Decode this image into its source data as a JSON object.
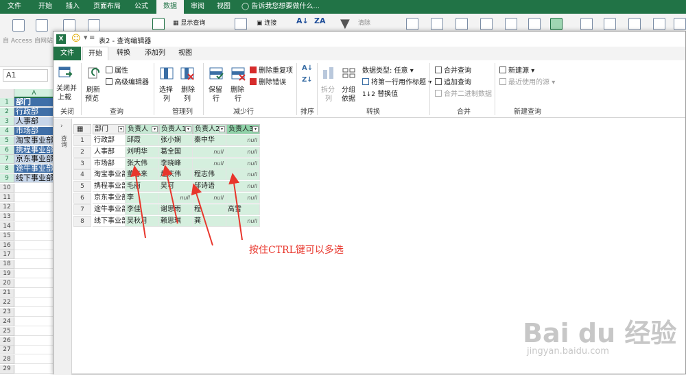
{
  "excel": {
    "tabs": [
      {
        "label": "文件"
      },
      {
        "label": "开始"
      },
      {
        "label": "插入"
      },
      {
        "label": "页面布局"
      },
      {
        "label": "公式"
      },
      {
        "label": "数据",
        "active": true
      },
      {
        "label": "审阅"
      },
      {
        "label": "视图"
      }
    ],
    "tell_me": "告诉我您想要做什么...",
    "ribbon_labels": {
      "show_query": "显示查询",
      "connections": "连接",
      "clear": "清除",
      "from_access": "自 Access",
      "from_web": "自网站"
    },
    "name_box": "A1",
    "column_a": "A",
    "rows": [
      "1",
      "2",
      "3",
      "4",
      "5",
      "6",
      "7",
      "8",
      "9",
      "10",
      "11",
      "12",
      "13",
      "14",
      "15",
      "16",
      "17",
      "18",
      "19",
      "20",
      "21",
      "22",
      "23",
      "24",
      "25",
      "26",
      "27",
      "28",
      "29"
    ],
    "col_a_values": [
      "部门",
      "行政部",
      "人事部",
      "市场部",
      "淘宝事业部",
      "携程事业部",
      "京东事业部",
      "途牛事业部",
      "线下事业部"
    ]
  },
  "qe": {
    "title": "表2 - 查询编辑器",
    "tabs": [
      {
        "label": "文件"
      },
      {
        "label": "开始"
      },
      {
        "label": "转换"
      },
      {
        "label": "添加列"
      },
      {
        "label": "视图"
      }
    ],
    "groups": {
      "close": "关闭",
      "query": "查询",
      "manage_cols": "管理列",
      "reduce_rows": "减少行",
      "sort": "排序",
      "transform": "转换",
      "combine": "合并",
      "new_query": "新建查询"
    },
    "buttons": {
      "close_load_1": "关闭并",
      "close_load_2": "上载",
      "refresh_1": "刷新",
      "refresh_2": "预览",
      "properties": "属性",
      "adv_editor": "高级编辑器",
      "choose_cols_1": "选择",
      "choose_cols_2": "列",
      "remove_cols_1": "删除",
      "remove_cols_2": "列",
      "keep_rows_1": "保留",
      "keep_rows_2": "行",
      "remove_rows_1": "删除",
      "remove_rows_2": "行",
      "remove_dup": "删除重复项",
      "remove_err": "删除错误",
      "split_1": "拆分",
      "split_2": "列",
      "group_1": "分组",
      "group_2": "依据",
      "data_type": "数据类型: 任意",
      "first_row": "将第一行用作标题",
      "replace": "替换值",
      "merge": "合并查询",
      "append": "追加查询",
      "combine_bin": "合并二进制数据",
      "new_source": "新建源",
      "recent": "最近使用的源"
    },
    "side_label": "查询",
    "columns": [
      "部门",
      "负责人",
      "负责人1",
      "负责人2",
      "负责人3"
    ],
    "rows": [
      [
        "1",
        "行政部",
        "邱霞",
        "张小娴",
        "秦中华",
        "null"
      ],
      [
        "2",
        "人事部",
        "刘明华",
        "葛全国",
        "null",
        "null"
      ],
      [
        "3",
        "市场部",
        "张大伟",
        "李晓峰",
        "null",
        "null"
      ],
      [
        "4",
        "淘宝事业部",
        "董春来",
        "赵庆伟",
        "程志伟",
        "null"
      ],
      [
        "5",
        "携程事业部",
        "毛丽",
        "吴可",
        "邱诗语",
        "null"
      ],
      [
        "6",
        "京东事业部",
        "李",
        "null",
        "null",
        "null"
      ],
      [
        "7",
        "途牛事业部",
        "李佳",
        "谢思雨",
        "程",
        "高雪"
      ],
      [
        "8",
        "线下事业部",
        "吴秋月",
        "赖思琪",
        "龚",
        "null"
      ]
    ]
  },
  "annotation": "按住CTRL键可以多选",
  "watermark": {
    "main": "Bai du 经验",
    "sub": "jingyan.baidu.com"
  }
}
